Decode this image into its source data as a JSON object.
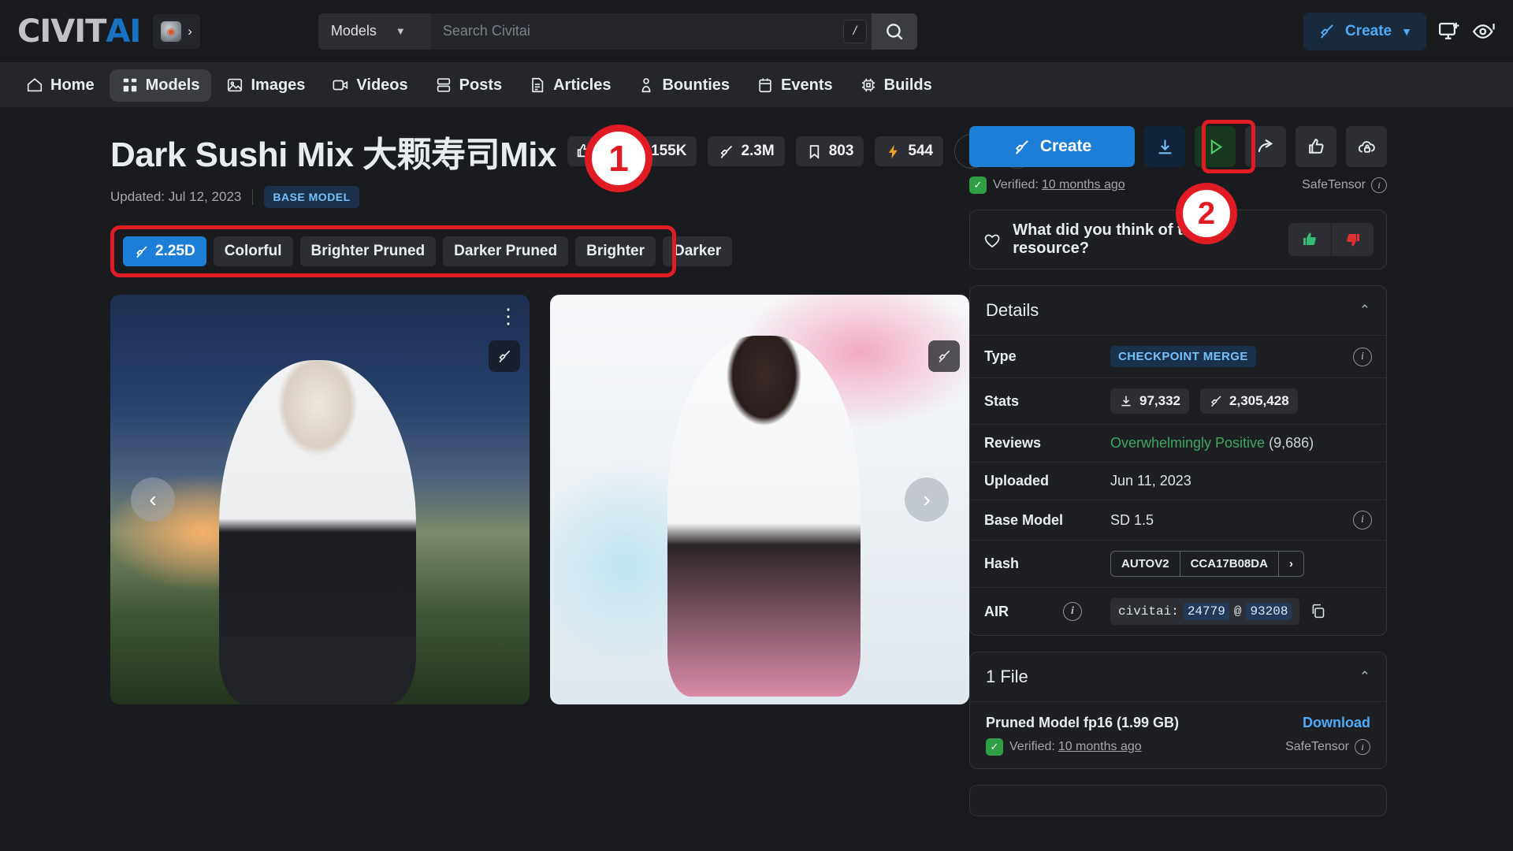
{
  "header": {
    "logo_civit": "CIVIT",
    "logo_ai": "AI",
    "logo_badge_icon": "cube-icon",
    "logo_badge_chevron": "›",
    "search": {
      "category_label": "Models",
      "placeholder": "Search Civitai",
      "value": "",
      "shortcut_key": "/",
      "search_icon": "search-icon"
    },
    "create_button": "Create",
    "create_chevron": "⌄",
    "icons": [
      "monitor-add-icon",
      "eye-notification-icon"
    ]
  },
  "nav": {
    "items": [
      {
        "label": "Home",
        "icon": "home-icon",
        "active": false
      },
      {
        "label": "Models",
        "icon": "grid-icon",
        "active": true
      },
      {
        "label": "Images",
        "icon": "image-icon",
        "active": false
      },
      {
        "label": "Videos",
        "icon": "video-icon",
        "active": false
      },
      {
        "label": "Posts",
        "icon": "posts-icon",
        "active": false
      },
      {
        "label": "Articles",
        "icon": "article-icon",
        "active": false
      },
      {
        "label": "Bounties",
        "icon": "bounty-icon",
        "active": false
      },
      {
        "label": "Events",
        "icon": "calendar-icon",
        "active": false
      },
      {
        "label": "Builds",
        "icon": "chip-icon",
        "active": false
      }
    ]
  },
  "model": {
    "title": "Dark Sushi Mix 大颗寿司Mix",
    "updated_label": "Updated: Jul 12, 2023",
    "base_model_badge": "BASE MODEL",
    "stats": [
      {
        "icon": "thumbs-up-icon",
        "value": ""
      },
      {
        "icon": "download-icon",
        "value": "155K"
      },
      {
        "icon": "brush-icon",
        "value": "2.3M"
      },
      {
        "icon": "bookmark-icon",
        "value": "803"
      },
      {
        "icon": "bolt-icon",
        "value": "544"
      }
    ],
    "title_actions": [
      "info-icon",
      "bell-plus-icon",
      "more-vertical-icon"
    ],
    "version_tags": [
      {
        "label": "2.25D",
        "active": true,
        "icon": "brush-icon"
      },
      {
        "label": "Colorful",
        "active": false
      },
      {
        "label": "Brighter Pruned",
        "active": false
      },
      {
        "label": "Darker Pruned",
        "active": false
      },
      {
        "label": "Brighter",
        "active": false
      },
      {
        "label": "Darker",
        "active": false
      }
    ]
  },
  "gallery": {
    "cards": [
      {
        "name": "gallery-image-1",
        "menu_icon": "more-vertical-icon",
        "brush_icon": "brush-icon"
      },
      {
        "name": "gallery-image-2",
        "menu_icon": "more-vertical-icon",
        "brush_icon": "brush-icon"
      }
    ],
    "prev_arrow": "‹",
    "next_arrow": "›"
  },
  "sidebar": {
    "create_button": "Create",
    "action_icons": [
      "download-icon",
      "run-icon",
      "share-icon",
      "thumbs-up-icon",
      "cloud-lock-icon"
    ],
    "verified_text": "Verified:",
    "verified_time": "10 months ago",
    "safetensor_label": "SafeTensor",
    "feedback_prompt": "What did you think of this resource?",
    "feedback_icons": {
      "heart": "heart-icon",
      "up": "thumbs-up-icon",
      "down": "thumbs-down-icon"
    },
    "details": {
      "heading": "Details",
      "collapse_chevron": "⌃",
      "rows": [
        {
          "key": "Type",
          "value": "CHECKPOINT MERGE",
          "kind": "badge",
          "info": true
        },
        {
          "key": "Stats",
          "kind": "stats",
          "downloads": "97,332",
          "generations": "2,305,428"
        },
        {
          "key": "Reviews",
          "kind": "reviews",
          "sentiment": "Overwhelmingly Positive",
          "count": "(9,686)"
        },
        {
          "key": "Uploaded",
          "value": "Jun 11, 2023",
          "kind": "text"
        },
        {
          "key": "Base Model",
          "value": "SD 1.5",
          "kind": "text",
          "info": true
        },
        {
          "key": "Hash",
          "kind": "hash",
          "algo": "AUTOV2",
          "hash": "CCA17B08DA",
          "expand": "›"
        },
        {
          "key": "AIR",
          "kind": "air",
          "prefix": "civitai:",
          "model_id": "24779",
          "at": "@",
          "version_id": "93208",
          "copy_icon": "copy-icon"
        }
      ]
    },
    "files": {
      "heading": "1 File",
      "collapse_chevron": "⌃",
      "items": [
        {
          "name": "Pruned Model fp16 (1.99 GB)",
          "download_label": "Download",
          "verified_text": "Verified:",
          "verified_time": "10 months ago",
          "safetensor_label": "SafeTensor"
        }
      ]
    }
  },
  "callouts": [
    {
      "id": "1",
      "label": "1"
    },
    {
      "id": "2",
      "label": "2"
    }
  ],
  "colors": {
    "brand_blue": "#1c7ed6",
    "accent_link": "#4dabf7",
    "callout_red": "#e01b24",
    "positive_green": "#40a662",
    "page_bg": "#1a1b1e",
    "nav_bg": "#25262b"
  }
}
